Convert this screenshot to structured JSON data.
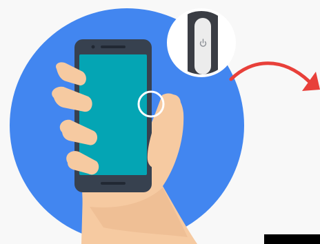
{
  "illustration": {
    "colors": {
      "background": "#f8f8f8",
      "circle": "#4286f0",
      "phone_body": "#37414f",
      "phone_screen": "#04a5b4",
      "hand": "#f6caa1",
      "hand_shadow": "#e9b78d",
      "sleeve": "#ffffff",
      "highlight_ring": "#ffffff",
      "arrow": "#e8403a",
      "button_bezel": "#3a3d44",
      "button": "#ececec"
    },
    "icons": {
      "phone": "smartphone-icon",
      "zoom": "magnifier-detail-icon",
      "arrow": "arrow-right-icon",
      "power": "power-icon"
    }
  }
}
